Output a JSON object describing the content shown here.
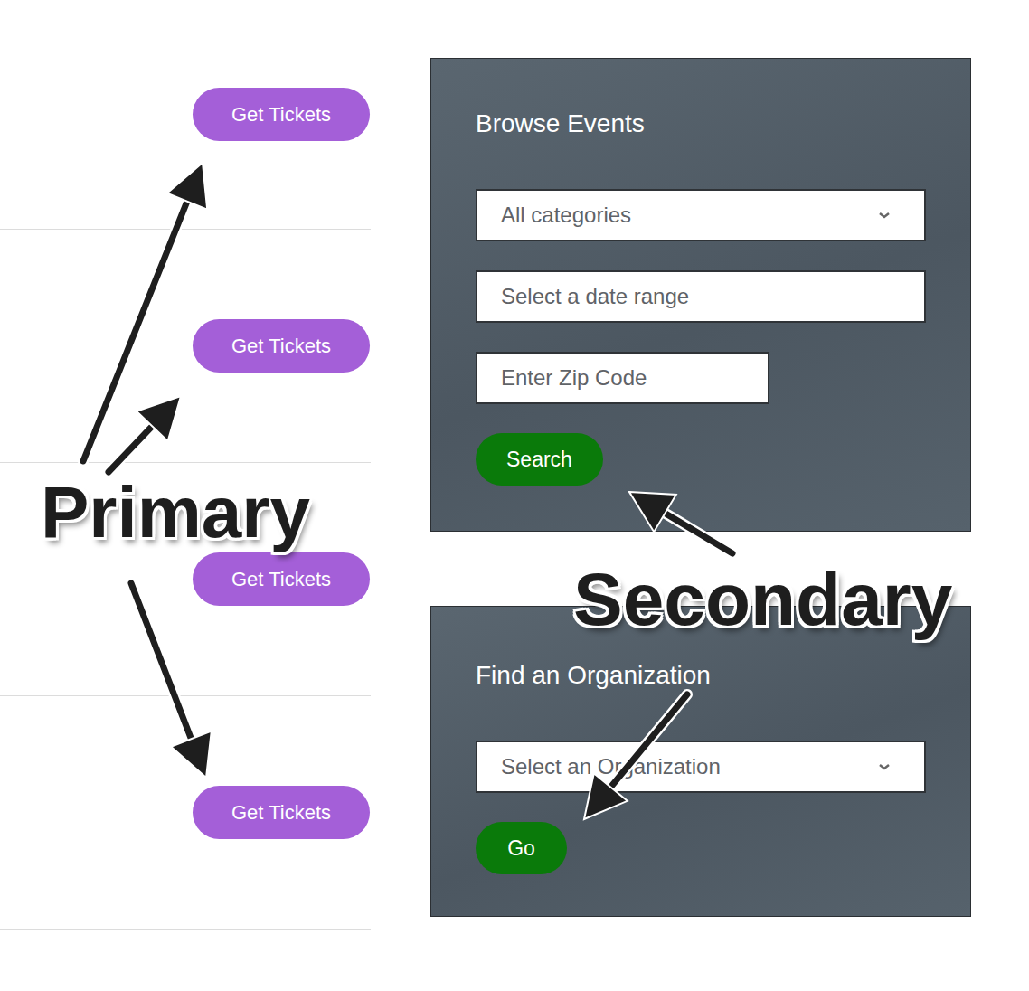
{
  "event_list": {
    "rows": [
      {
        "button": "Get Tickets"
      },
      {
        "button": "Get Tickets"
      },
      {
        "button": "Get Tickets"
      },
      {
        "button": "Get Tickets"
      }
    ]
  },
  "panels": [
    {
      "title": "Browse Events",
      "fields": [
        {
          "kind": "select",
          "placeholder": "All categories"
        },
        {
          "kind": "text",
          "placeholder": "Select a date range"
        },
        {
          "kind": "short",
          "placeholder": "Enter Zip Code"
        }
      ],
      "button": "Search"
    },
    {
      "title": "Find an Organization",
      "fields": [
        {
          "kind": "select",
          "placeholder": "Select an Organization"
        }
      ],
      "button": "Go"
    }
  ],
  "annotations": [
    {
      "label": "Primary"
    },
    {
      "label": "Secondary"
    }
  ]
}
